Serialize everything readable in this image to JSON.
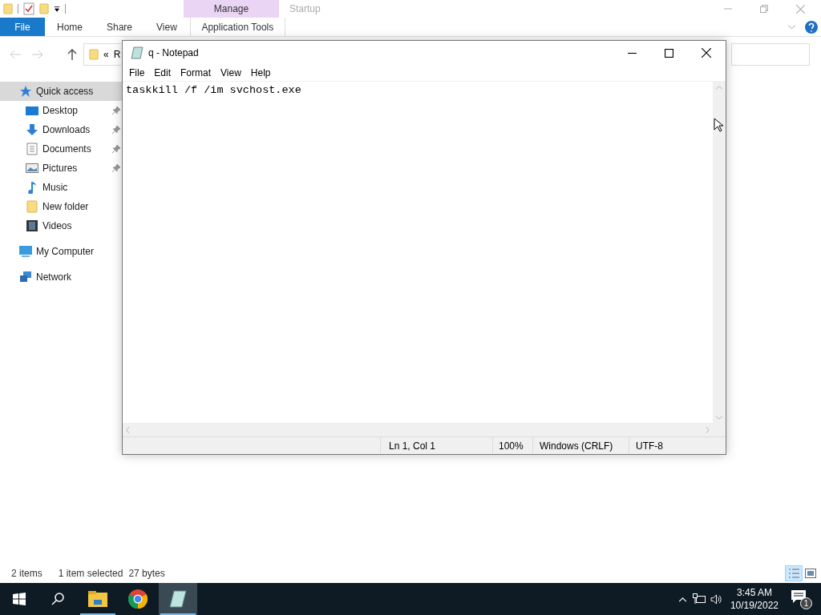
{
  "explorer": {
    "ribbon": {
      "contextual_group": "Manage",
      "inactive_group": "Startup",
      "tabs": [
        {
          "label": "File",
          "kind": "file"
        },
        {
          "label": "Home",
          "kind": "normal"
        },
        {
          "label": "Share",
          "kind": "normal"
        },
        {
          "label": "View",
          "kind": "normal"
        },
        {
          "label": "Application Tools",
          "kind": "contextual"
        }
      ]
    },
    "address": {
      "chevron": "«",
      "text": "R"
    },
    "nav": [
      {
        "label": "Quick access",
        "kind": "star",
        "selected": true,
        "children": [
          {
            "label": "Desktop",
            "kind": "desktop",
            "pinned": true,
            "selected": false
          },
          {
            "label": "Downloads",
            "kind": "download",
            "pinned": true,
            "selected": false
          },
          {
            "label": "Documents",
            "kind": "document",
            "pinned": true,
            "selected": false
          },
          {
            "label": "Pictures",
            "kind": "pictures",
            "pinned": true,
            "selected": false
          },
          {
            "label": "Music",
            "kind": "music",
            "pinned": false,
            "selected": false
          },
          {
            "label": "New folder",
            "kind": "folder",
            "pinned": false,
            "selected": false
          },
          {
            "label": "Videos",
            "kind": "video",
            "pinned": false,
            "selected": false
          }
        ]
      },
      {
        "label": "My Computer",
        "kind": "computer",
        "selected": false
      },
      {
        "label": "Network",
        "kind": "network",
        "selected": false
      }
    ],
    "status": [
      "2 items",
      "1 item selected",
      "27 bytes"
    ]
  },
  "notepad": {
    "title": "q - Notepad",
    "menu": [
      "File",
      "Edit",
      "Format",
      "View",
      "Help"
    ],
    "text": "taskkill /f /im svchost.exe",
    "status": [
      "Ln 1, Col 1",
      "100%",
      "Windows (CRLF)",
      "UTF-8"
    ]
  },
  "taskbar": {
    "apps": [
      {
        "kind": "explorer",
        "selected": false,
        "running": true
      },
      {
        "kind": "chrome",
        "selected": false,
        "running": false
      },
      {
        "kind": "notepad",
        "selected": true,
        "running": true
      }
    ],
    "time": "3:45 AM",
    "date": "10/19/2022",
    "notifications": "1"
  }
}
